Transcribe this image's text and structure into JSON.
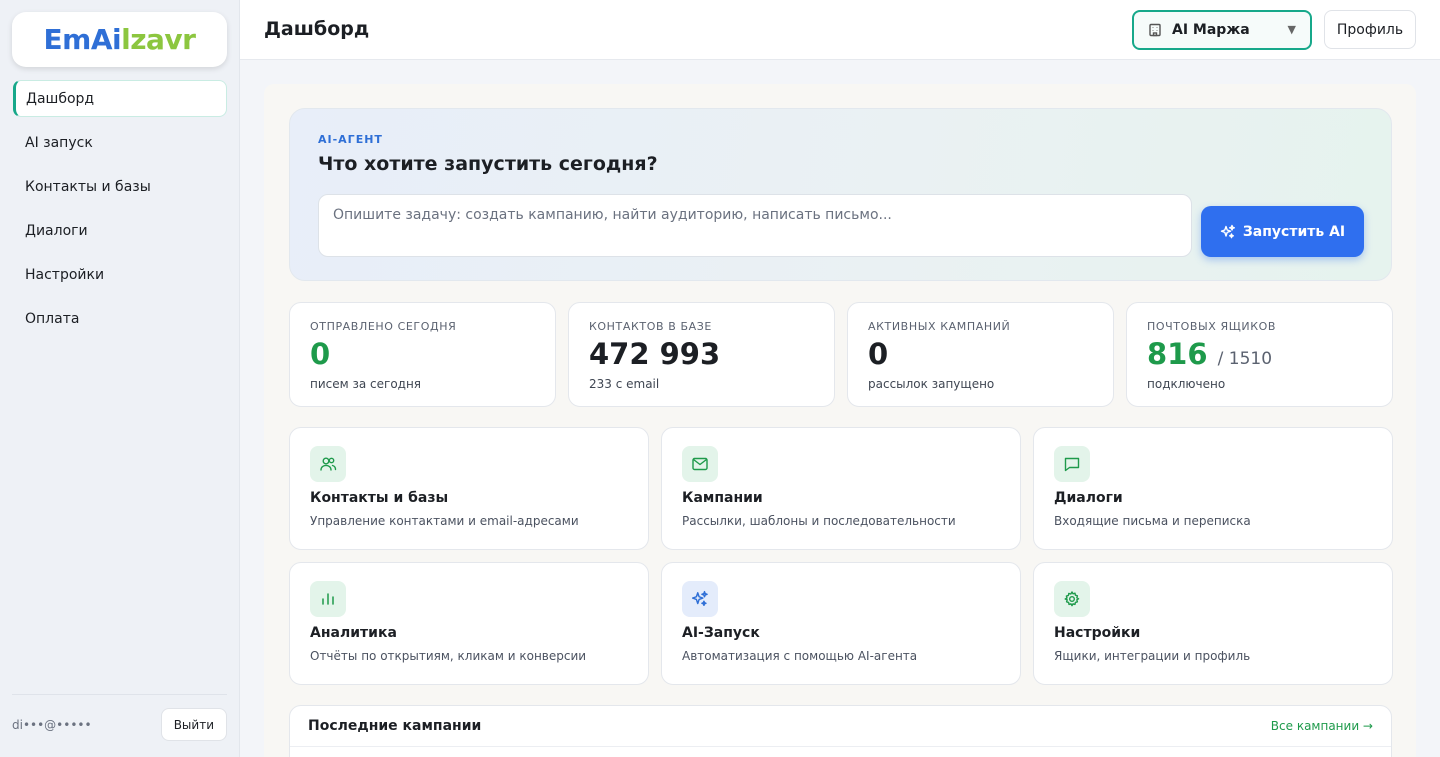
{
  "brand": {
    "em": "Em",
    "ai": "Ai",
    "zavr": "lzavr"
  },
  "sidebar": {
    "items": [
      {
        "label": "Дашборд",
        "active": true
      },
      {
        "label": "AI запуск"
      },
      {
        "label": "Контакты и базы"
      },
      {
        "label": "Диалоги"
      },
      {
        "label": "Настройки"
      },
      {
        "label": "Оплата"
      }
    ],
    "user_email": "di•••@•••••",
    "logout_label": "Выйти"
  },
  "header": {
    "title": "Дашборд",
    "org": "AI Маржа",
    "profile_label": "Профиль"
  },
  "hero": {
    "eyebrow": "AI-АГЕНТ",
    "title": "Что хотите запустить сегодня?",
    "placeholder": "Опишите задачу: создать кампанию, найти аудиторию, написать письмо...",
    "run_label": "Запустить AI"
  },
  "stats": [
    {
      "label": "ОТПРАВЛЕНО СЕГОДНЯ",
      "value": "0",
      "sub": "писем за сегодня",
      "color": "#1e9a4b"
    },
    {
      "label": "КОНТАКТОВ В БАЗЕ",
      "value": "472 993",
      "sub": "233 с email"
    },
    {
      "label": "АКТИВНЫХ КАМПАНИЙ",
      "value": "0",
      "sub": "рассылок запущено"
    },
    {
      "label": "ПОЧТОВЫХ ЯЩИКОВ",
      "value": "816",
      "total": "/ 1510",
      "sub": "подключено",
      "color": "#1e9a4b"
    }
  ],
  "cards": [
    {
      "title": "Контакты и базы",
      "desc": "Управление контактами и email-адресами",
      "icon": "users-icon"
    },
    {
      "title": "Кампании",
      "desc": "Рассылки, шаблоны и последовательности",
      "icon": "mail-icon"
    },
    {
      "title": "Диалоги",
      "desc": "Входящие письма и переписка",
      "icon": "chat-icon"
    },
    {
      "title": "Аналитика",
      "desc": "Отчёты по открытиям, кликам и конверсии",
      "icon": "bar-chart-icon"
    },
    {
      "title": "AI-Запуск",
      "desc": "Автоматизация с помощью AI-агента",
      "icon": "sparkles-icon"
    },
    {
      "title": "Настройки",
      "desc": "Ящики, интеграции и профиль",
      "icon": "gear-icon"
    }
  ],
  "recent": {
    "title": "Последние кампании",
    "link": "Все кампании →"
  }
}
